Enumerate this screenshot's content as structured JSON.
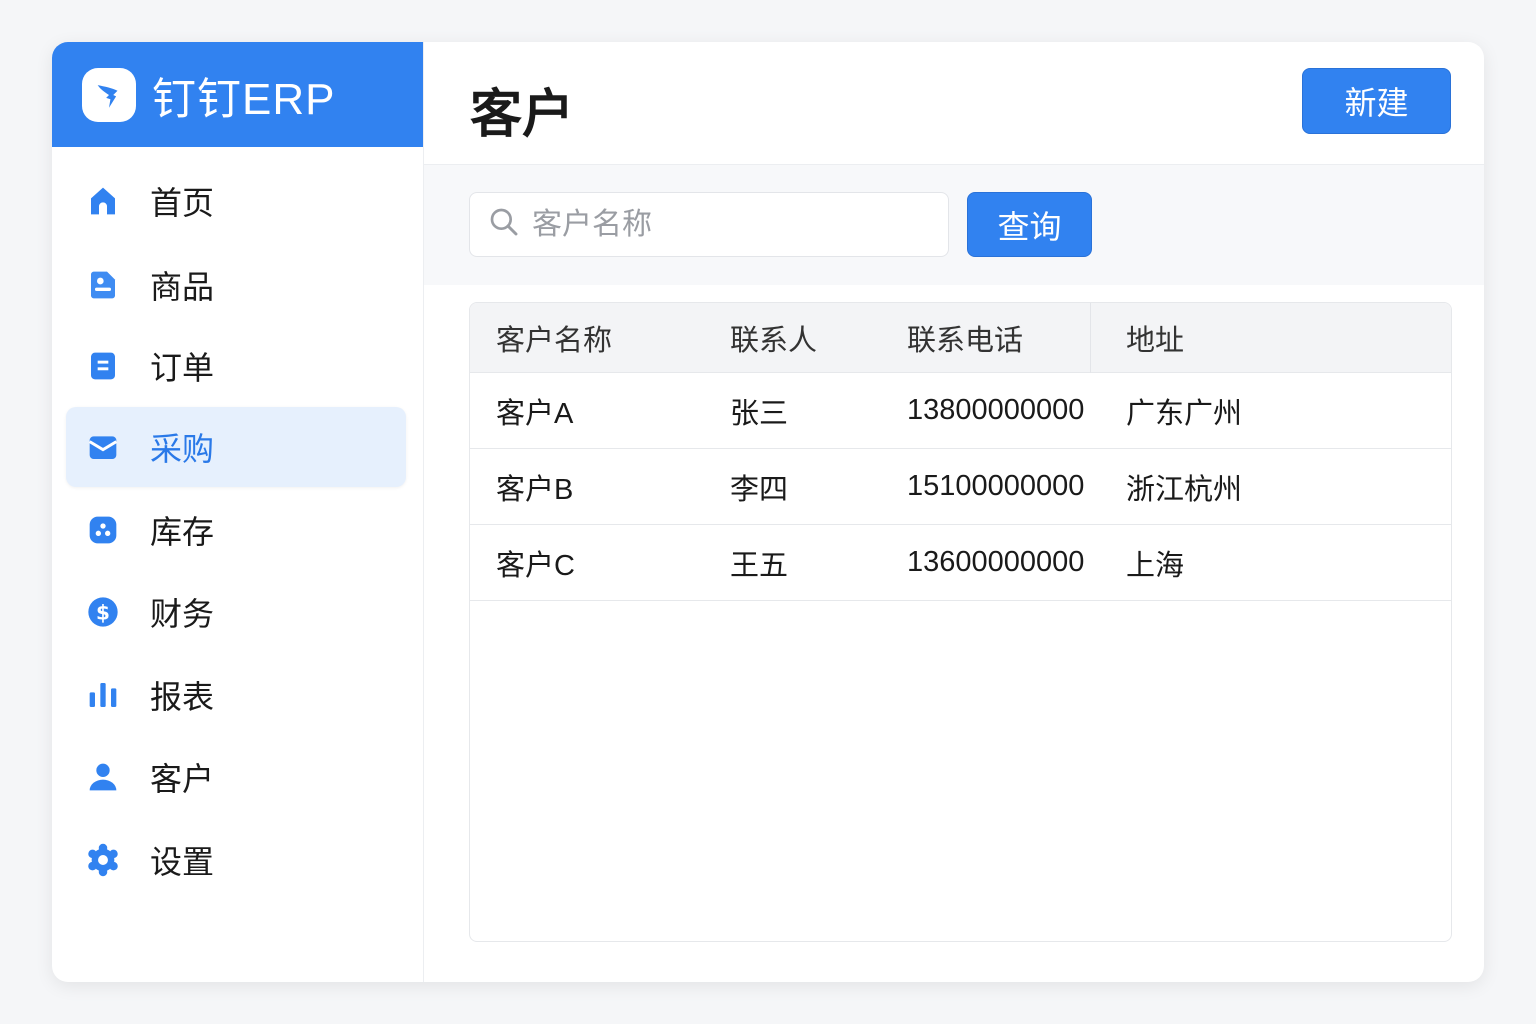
{
  "brand": {
    "name": "钉钉ERP"
  },
  "sidebar": {
    "items": [
      {
        "label": "首页",
        "icon": "home-icon"
      },
      {
        "label": "商品",
        "icon": "product-icon"
      },
      {
        "label": "订单",
        "icon": "order-icon"
      },
      {
        "label": "采购",
        "icon": "mail-icon",
        "active": true
      },
      {
        "label": "库存",
        "icon": "inventory-icon"
      },
      {
        "label": "财务",
        "icon": "dollar-icon"
      },
      {
        "label": "报表",
        "icon": "bar-chart-icon"
      },
      {
        "label": "客户",
        "icon": "user-icon"
      },
      {
        "label": "设置",
        "icon": "gear-icon"
      }
    ]
  },
  "header": {
    "title": "客户",
    "new_label": "新建"
  },
  "search": {
    "placeholder": "客户名称",
    "query_label": "查询"
  },
  "table": {
    "columns": [
      "客户名称",
      "联系人",
      "联系电话",
      "地址"
    ],
    "rows": [
      [
        "客户A",
        "张三",
        "13800000000",
        "广东广州"
      ],
      [
        "客户B",
        "李四",
        "15100000000",
        "浙江杭州"
      ],
      [
        "客户C",
        "王五",
        "13600000000",
        "上海"
      ]
    ]
  },
  "colors": {
    "accent": "#3182f0",
    "active_bg": "#e6f0fd"
  }
}
